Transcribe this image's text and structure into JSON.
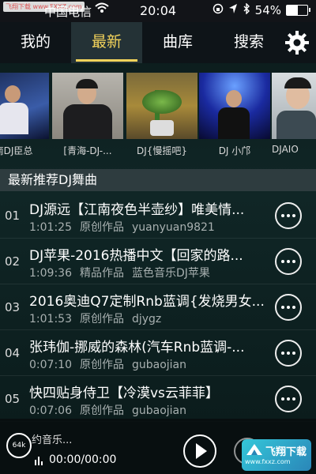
{
  "status_bar": {
    "carrier": "中国电信",
    "time": "20:04",
    "battery": "54%",
    "battery_level": 0.54,
    "watermark": "飞翔下载 www.FXXZ.com"
  },
  "tabs": [
    {
      "label": "我的"
    },
    {
      "label": "最新"
    },
    {
      "label": "曲库"
    },
    {
      "label": "搜索"
    }
  ],
  "accent_color": "#f3d35b",
  "featured": [
    {
      "caption": "南DJ臣总"
    },
    {
      "caption": "[青海-DJ-..."
    },
    {
      "caption": "DJ{慢摇吧}"
    },
    {
      "caption": "DJ 小邝"
    },
    {
      "caption": "DJAIO"
    }
  ],
  "section_title": "最新推荐DJ舞曲",
  "songs": [
    {
      "num": "01",
      "title": "DJ源远【江南夜色半壶纱】唯美情...",
      "duration": "1:01:25",
      "category": "原创作品",
      "author": "yuanyuan9821"
    },
    {
      "num": "02",
      "title": "DJ苹果-2016热播中文【回家的路...",
      "duration": "1:09:36",
      "category": "精品作品",
      "author": "蓝色音乐DJ苹果"
    },
    {
      "num": "03",
      "title": "2016奥迪Q7定制Rnb蓝调{发烧男女...",
      "duration": "1:01:53",
      "category": "原创作品",
      "author": "djygz"
    },
    {
      "num": "04",
      "title": "张玮伽-挪威的森林(汽车Rnb蓝调-...",
      "duration": "0:07:10",
      "category": "原创作品",
      "author": "gubaojian"
    },
    {
      "num": "05",
      "title": "快四贴身侍卫【冷漠vs云菲菲】",
      "duration": "0:07:06",
      "category": "原创作品",
      "author": "gubaojian"
    }
  ],
  "player": {
    "bitrate": "64k",
    "title": "约音乐...",
    "time": "00:00/00:00"
  },
  "logo": {
    "text": "飞翔下载",
    "url": "www.fxxz.com"
  }
}
